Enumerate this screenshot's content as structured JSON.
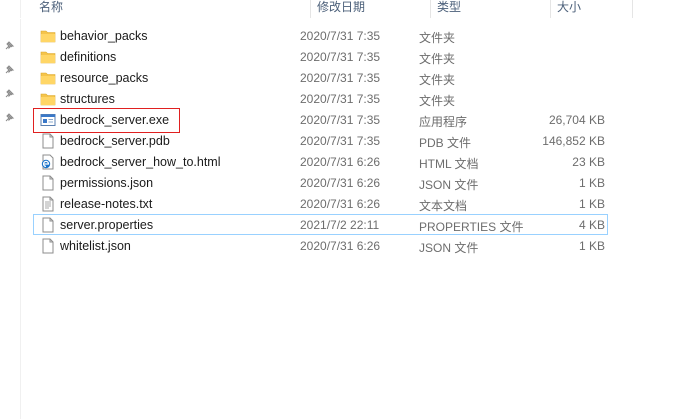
{
  "columns": {
    "name": "名称",
    "date": "修改日期",
    "type": "类型",
    "size": "大小"
  },
  "files": [
    {
      "name": "behavior_packs",
      "date": "2020/7/31 7:35",
      "type": "文件夹",
      "size": "",
      "icon": "folder-icon"
    },
    {
      "name": "definitions",
      "date": "2020/7/31 7:35",
      "type": "文件夹",
      "size": "",
      "icon": "folder-icon"
    },
    {
      "name": "resource_packs",
      "date": "2020/7/31 7:35",
      "type": "文件夹",
      "size": "",
      "icon": "folder-icon"
    },
    {
      "name": "structures",
      "date": "2020/7/31 7:35",
      "type": "文件夹",
      "size": "",
      "icon": "folder-icon"
    },
    {
      "name": "bedrock_server.exe",
      "date": "2020/7/31 7:35",
      "type": "应用程序",
      "size": "26,704 KB",
      "icon": "exe-icon"
    },
    {
      "name": "bedrock_server.pdb",
      "date": "2020/7/31 7:35",
      "type": "PDB 文件",
      "size": "146,852 KB",
      "icon": "file-icon"
    },
    {
      "name": "bedrock_server_how_to.html",
      "date": "2020/7/31 6:26",
      "type": "HTML 文档",
      "size": "23 KB",
      "icon": "edge-html-icon"
    },
    {
      "name": "permissions.json",
      "date": "2020/7/31 6:26",
      "type": "JSON 文件",
      "size": "1 KB",
      "icon": "file-icon"
    },
    {
      "name": "release-notes.txt",
      "date": "2020/7/31 6:26",
      "type": "文本文档",
      "size": "1 KB",
      "icon": "text-file-icon"
    },
    {
      "name": "server.properties",
      "date": "2021/7/2 22:11",
      "type": "PROPERTIES 文件",
      "size": "4 KB",
      "icon": "file-icon"
    },
    {
      "name": "whitelist.json",
      "date": "2020/7/31 6:26",
      "type": "JSON 文件",
      "size": "1 KB",
      "icon": "file-icon"
    }
  ],
  "colors": {
    "folder": "#f5c44b",
    "selection_border": "#99d1ff",
    "annotation_box": "#e02020"
  }
}
